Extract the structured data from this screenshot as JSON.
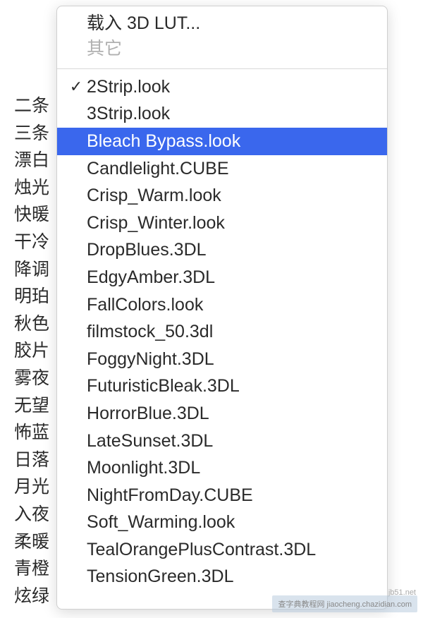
{
  "header": {
    "load_lut": "载入 3D LUT...",
    "other": "其它"
  },
  "labels_cn": [
    "二条",
    "三条",
    "漂白",
    "烛光",
    "快暖",
    "干冷",
    "降调",
    "明珀",
    "秋色",
    "胶片",
    "雾夜",
    "无望",
    "怖蓝",
    "日落",
    "月光",
    "入夜",
    "柔暖",
    "青橙",
    "炫绿"
  ],
  "items": [
    {
      "label": "2Strip.look",
      "checked": true,
      "selected": false
    },
    {
      "label": "3Strip.look",
      "checked": false,
      "selected": false
    },
    {
      "label": "Bleach Bypass.look",
      "checked": false,
      "selected": true
    },
    {
      "label": "Candlelight.CUBE",
      "checked": false,
      "selected": false
    },
    {
      "label": "Crisp_Warm.look",
      "checked": false,
      "selected": false
    },
    {
      "label": "Crisp_Winter.look",
      "checked": false,
      "selected": false
    },
    {
      "label": "DropBlues.3DL",
      "checked": false,
      "selected": false
    },
    {
      "label": "EdgyAmber.3DL",
      "checked": false,
      "selected": false
    },
    {
      "label": "FallColors.look",
      "checked": false,
      "selected": false
    },
    {
      "label": "filmstock_50.3dl",
      "checked": false,
      "selected": false
    },
    {
      "label": "FoggyNight.3DL",
      "checked": false,
      "selected": false
    },
    {
      "label": "FuturisticBleak.3DL",
      "checked": false,
      "selected": false
    },
    {
      "label": "HorrorBlue.3DL",
      "checked": false,
      "selected": false
    },
    {
      "label": "LateSunset.3DL",
      "checked": false,
      "selected": false
    },
    {
      "label": "Moonlight.3DL",
      "checked": false,
      "selected": false
    },
    {
      "label": "NightFromDay.CUBE",
      "checked": false,
      "selected": false
    },
    {
      "label": "Soft_Warming.look",
      "checked": false,
      "selected": false
    },
    {
      "label": "TealOrangePlusContrast.3DL",
      "checked": false,
      "selected": false
    },
    {
      "label": "TensionGreen.3DL",
      "checked": false,
      "selected": false
    }
  ],
  "watermark": {
    "site": "jb51.net",
    "credit": "查字典教程网 jiaocheng.chazidian.com"
  }
}
